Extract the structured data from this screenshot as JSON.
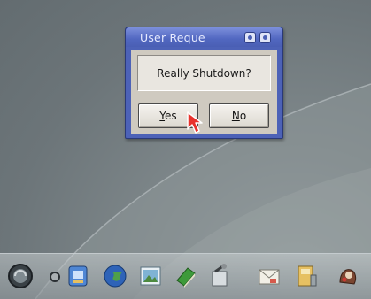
{
  "dialog": {
    "title": "User Reque",
    "message": "Really Shutdown?",
    "yes_label_ul": "Y",
    "yes_label_rest": "es",
    "no_label_ul": "N",
    "no_label_rest": "o"
  },
  "dock": {
    "icons": [
      "shutdown-icon",
      "finder-icon",
      "globe-icon",
      "picture-icon",
      "book-icon",
      "toolbox-icon",
      "mail-icon",
      "disk-icon",
      "game-icon"
    ]
  },
  "colors": {
    "titlebar": "#4d62b7",
    "dialog_body": "#cfcac0",
    "desktop": "#6c7579"
  }
}
